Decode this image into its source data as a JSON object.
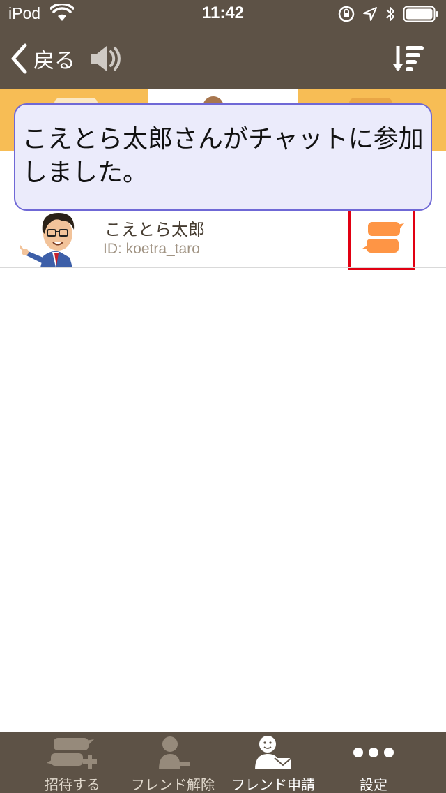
{
  "status_bar": {
    "carrier": "iPod",
    "time": "11:42",
    "icons": [
      "wifi-icon",
      "rotation-lock-icon",
      "location-icon",
      "bluetooth-icon",
      "battery-icon"
    ]
  },
  "nav": {
    "back_label": "戻る",
    "speaker_icon": "speaker-icon",
    "sort_icon": "sort-icon"
  },
  "toast": {
    "message": "こえとら太郎さんがチャットに参加しました。"
  },
  "friend": {
    "name": "こえとら太郎",
    "id_text": "ID: koetra_taro"
  },
  "toolbar": {
    "items": [
      {
        "label": "招待する",
        "icon": "invite-chat-icon"
      },
      {
        "label": "フレンド解除",
        "icon": "remove-friend-icon"
      },
      {
        "label": "フレンド申請",
        "icon": "friend-request-icon"
      },
      {
        "label": "設定",
        "icon": "more-icon"
      }
    ]
  },
  "colors": {
    "bar": "#5d5246",
    "tab_strip": "#f7bd55",
    "toast_bg": "#ebebfb",
    "toast_border": "#6f68d6",
    "chat_icon": "#fe9545",
    "highlight": "#e10012"
  }
}
